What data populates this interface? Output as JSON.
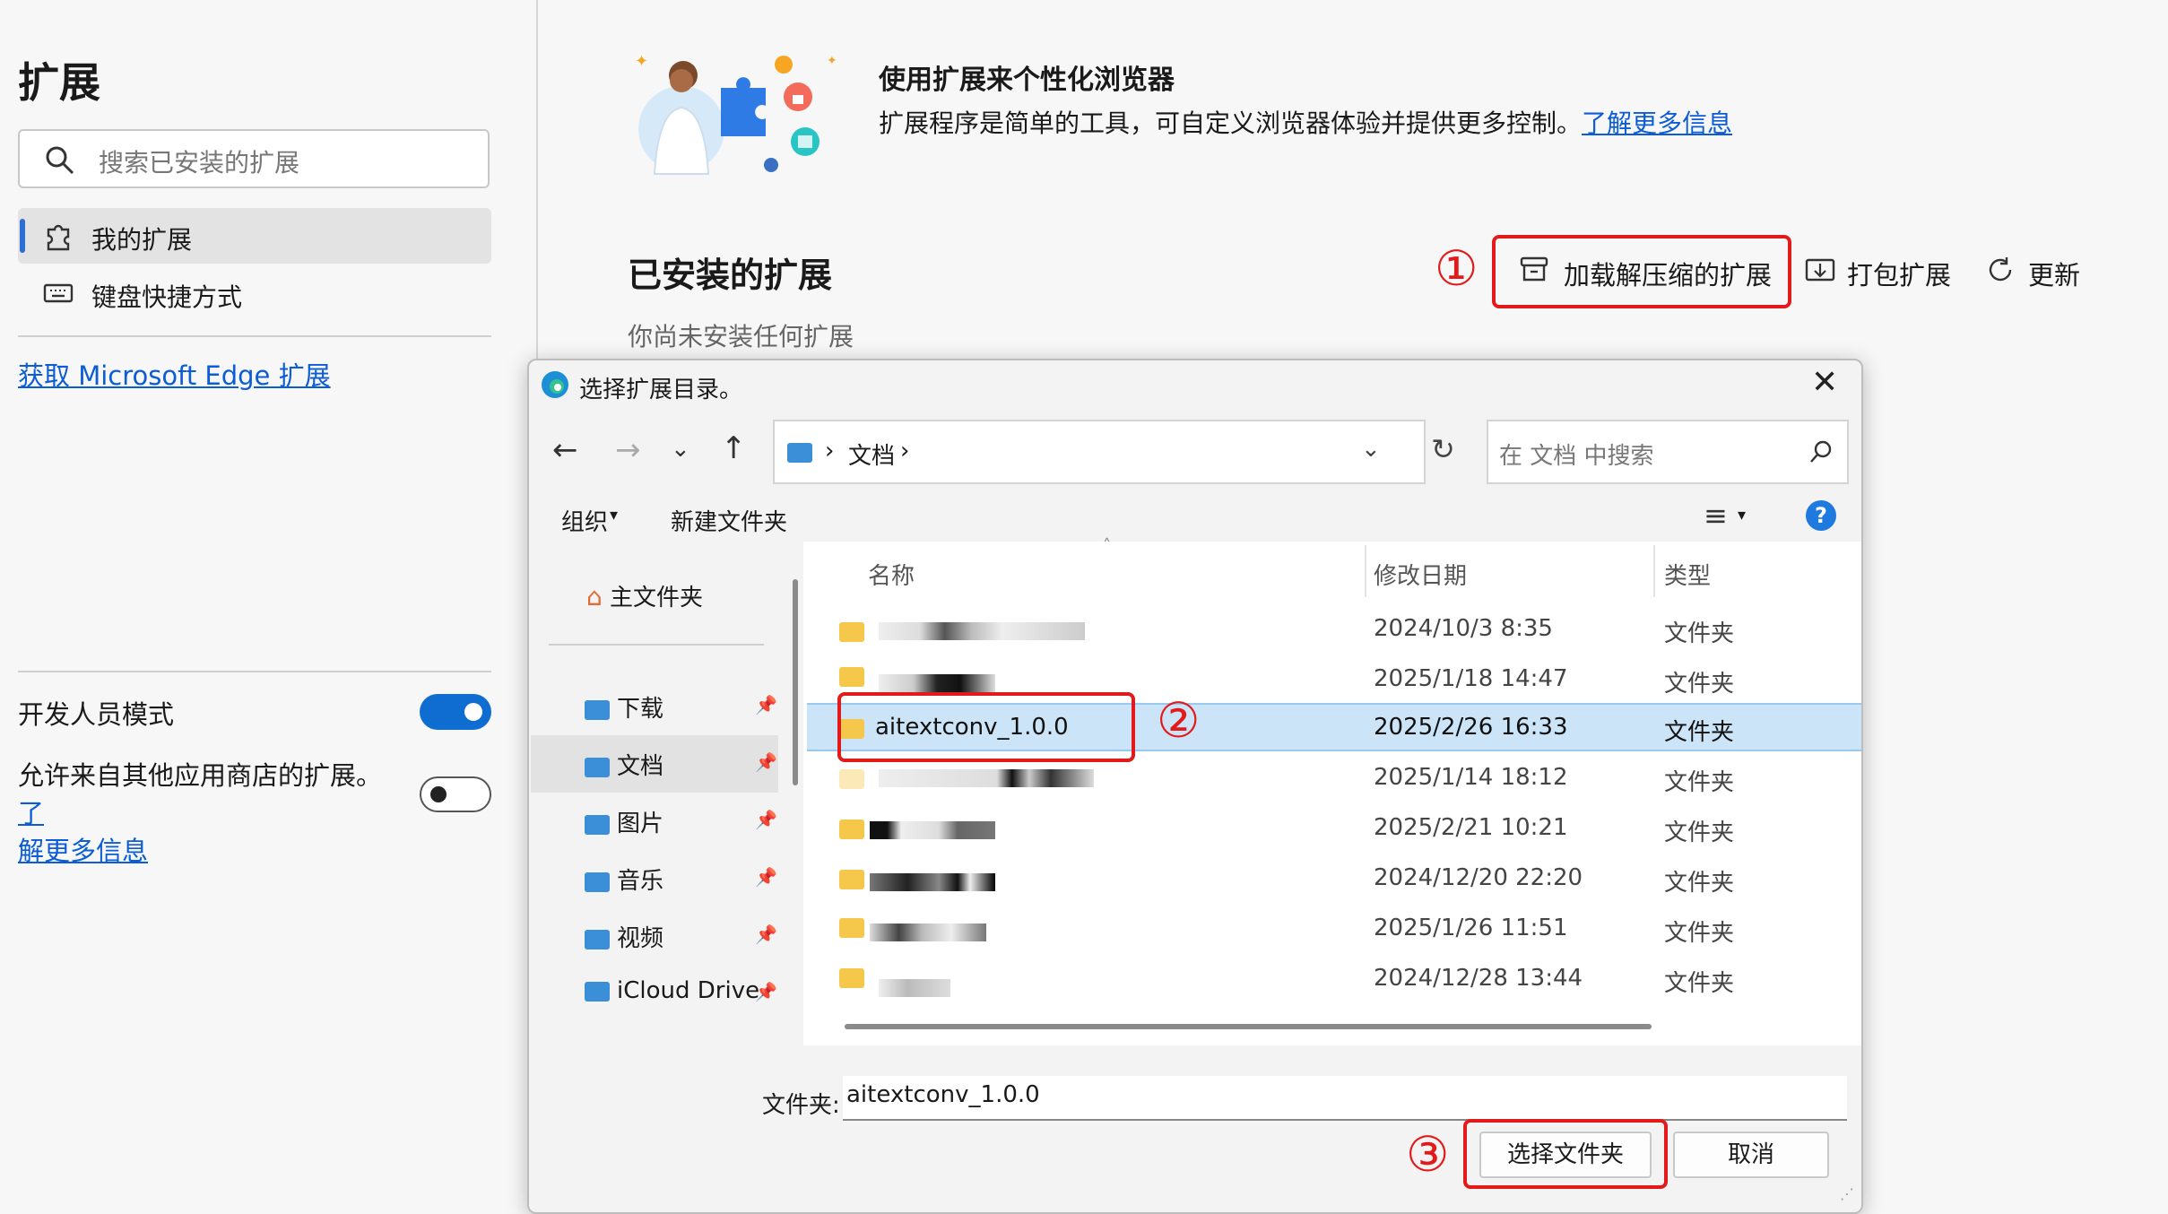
{
  "sidebar": {
    "title": "扩展",
    "search_placeholder": "搜索已安装的扩展",
    "nav": [
      {
        "label": "我的扩展",
        "icon": "puzzle-icon",
        "selected": true
      },
      {
        "label": "键盘快捷方式",
        "icon": "keyboard-icon",
        "selected": false
      }
    ],
    "get_link": "获取 Microsoft Edge 扩展",
    "dev_mode_label": "开发人员模式",
    "dev_mode_on": true,
    "other_stores_text": "允许来自其他应用商店的扩展。",
    "other_stores_link_1": "了",
    "other_stores_link_2": "解更多信息",
    "other_stores_on": false
  },
  "main": {
    "promo_title": "使用扩展来个性化浏览器",
    "promo_desc": "扩展程序是简单的工具，可自定义浏览器体验并提供更多控制。",
    "promo_link": "了解更多信息",
    "installed_title": "已安装的扩展",
    "empty_text": "你尚未安装任何扩展",
    "load_unpacked": "加载解压缩的扩展",
    "pack": "打包扩展",
    "update": "更新",
    "step1": "①",
    "step2": "②",
    "step3": "③",
    "accent": "#0f6cd1",
    "annotation_color": "#e21a1a"
  },
  "dialog": {
    "title": "选择扩展目录。",
    "breadcrumb": "文档",
    "search_placeholder": "在 文档 中搜索",
    "organize": "组织",
    "new_folder": "新建文件夹",
    "nav_items": [
      {
        "label": "主文件夹",
        "icon": "home-icon",
        "pinned": false
      },
      {
        "label": "下载",
        "icon": "download-folder-icon",
        "pinned": true
      },
      {
        "label": "文档",
        "icon": "documents-folder-icon",
        "pinned": true,
        "selected": true
      },
      {
        "label": "图片",
        "icon": "pictures-folder-icon",
        "pinned": true
      },
      {
        "label": "音乐",
        "icon": "music-folder-icon",
        "pinned": true
      },
      {
        "label": "视频",
        "icon": "videos-folder-icon",
        "pinned": true
      },
      {
        "label": "iCloud Drive",
        "icon": "icloud-folder-icon",
        "pinned": true
      }
    ],
    "columns": [
      "名称",
      "修改日期",
      "类型"
    ],
    "rows": [
      {
        "name": "",
        "date": "2024/10/3 8:35",
        "type": "文件夹"
      },
      {
        "name": "",
        "date": "2025/1/18 14:47",
        "type": "文件夹"
      },
      {
        "name": "aitextconv_1.0.0",
        "date": "2025/2/26 16:33",
        "type": "文件夹",
        "selected": true
      },
      {
        "name": "",
        "date": "2025/1/14 18:12",
        "type": "文件夹"
      },
      {
        "name": "",
        "date": "2025/2/21 10:21",
        "type": "文件夹"
      },
      {
        "name": "",
        "date": "2024/12/20 22:20",
        "type": "文件夹"
      },
      {
        "name": "",
        "date": "2025/1/26 11:51",
        "type": "文件夹"
      },
      {
        "name": "",
        "date": "2024/12/28 13:44",
        "type": "文件夹"
      }
    ],
    "folder_label": "文件夹:",
    "folder_value": "aitextconv_1.0.0",
    "select_button": "选择文件夹",
    "cancel_button": "取消"
  }
}
